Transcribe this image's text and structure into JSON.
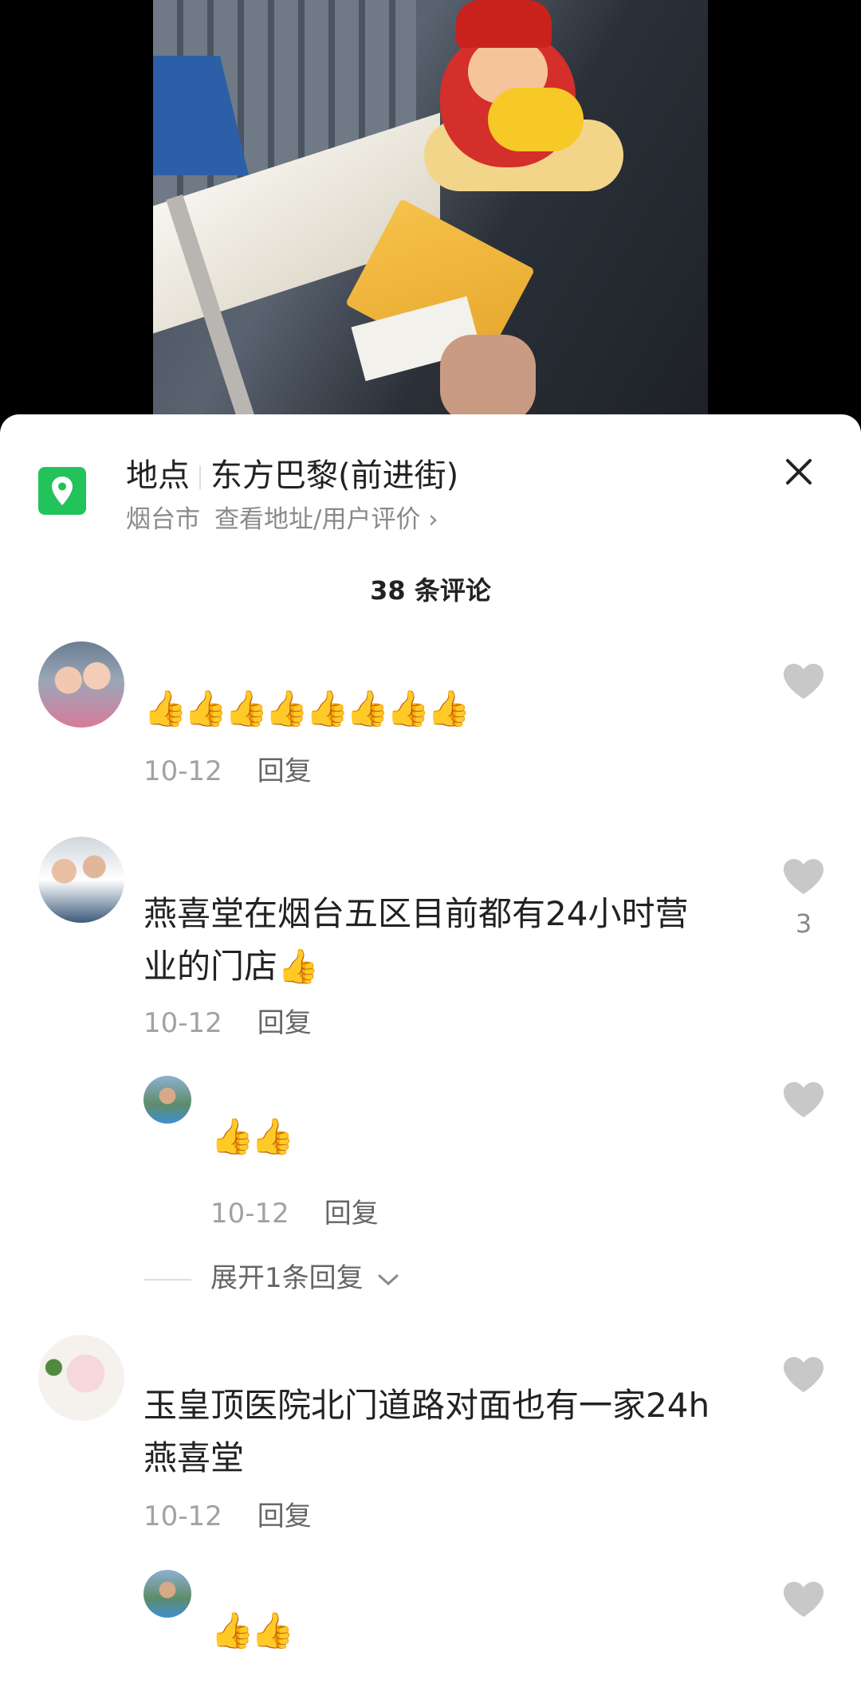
{
  "location": {
    "label": "地点",
    "name": "东方巴黎(前进街)",
    "city": "烟台市",
    "detail_link": "查看地址/用户评价"
  },
  "comments_count": "38 条评论",
  "comments": [
    {
      "text": "👍👍👍👍👍👍👍👍",
      "date": "10-12",
      "reply": "回复",
      "likes": ""
    },
    {
      "text": "燕喜堂在烟台五区目前都有24小时营",
      "text2": "业的门店👍",
      "date": "10-12",
      "reply": "回复",
      "likes": "3"
    },
    {
      "text": "👍👍",
      "date": "10-12",
      "reply": "回复",
      "likes": ""
    },
    {
      "text": "玉皇顶医院北门道路对面也有一家24h",
      "text2": "燕喜堂",
      "date": "10-12",
      "reply": "回复",
      "likes": ""
    },
    {
      "text": "👍👍",
      "date": "",
      "reply": "",
      "likes": ""
    }
  ],
  "expand_replies": "展开1条回复",
  "colors": {
    "location_icon": "#22c35b",
    "like_heart": "#c8c8c8"
  }
}
